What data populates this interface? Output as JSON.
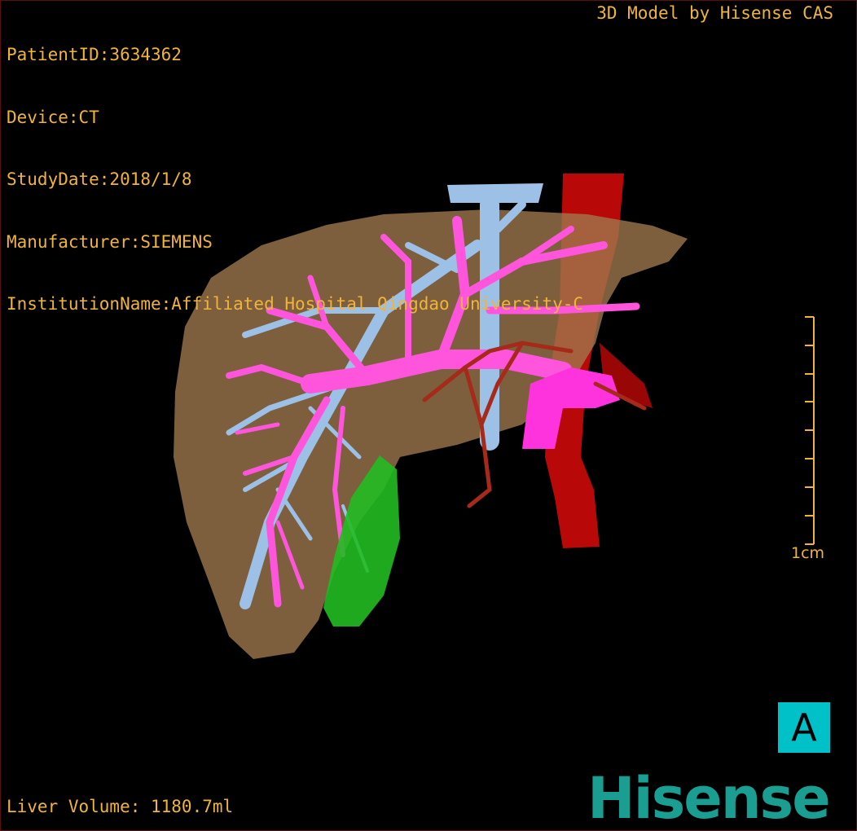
{
  "patient_info": {
    "patient_id": "PatientID:3634362",
    "device": "Device:CT",
    "study_date": "StudyDate:2018/1/8",
    "manufacturer": "Manufacturer:SIEMENS",
    "institution": "InstitutionName:Affiliated Hospital Qingdao University-C"
  },
  "credit": "3D Model by Hisense CAS",
  "liver_volume": "Liver Volume: 1180.7ml",
  "scale_bar": {
    "label": "1cm"
  },
  "orientation_label": "A",
  "brand": "Hisense",
  "colors": {
    "text": "#f0b43a",
    "liver": "#a07a4e",
    "hepatic_vein": "#9cc0e6",
    "portal_vein": "#ff55dd",
    "artery_aorta": "#b80808",
    "gallbladder": "#22bb22",
    "orientation_badge": "#00c0c8",
    "brand": "#1a9e92"
  }
}
